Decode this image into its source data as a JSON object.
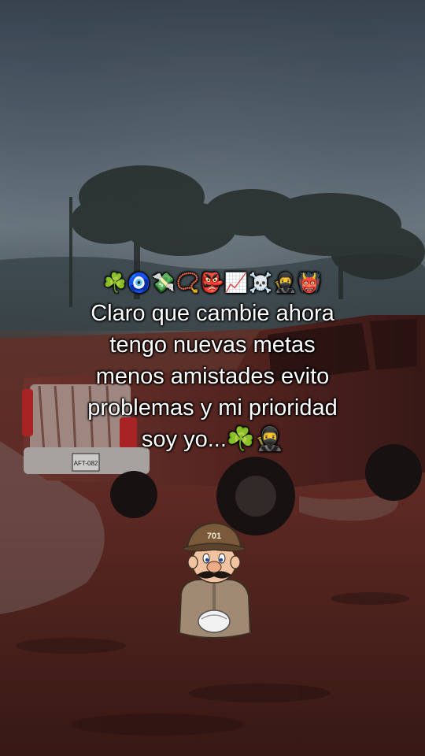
{
  "caption": {
    "emojis": "☘️🧿💸📿👺📈☠️🥷👹",
    "lines": [
      "Claro que cambie ahora",
      "tengo nuevas metas",
      "menos amistades evito",
      "problemas y mi prioridad",
      "soy yo...☘️🥷"
    ]
  },
  "mascot": {
    "hat_text": "701"
  },
  "truck": {
    "plate": "AFT-082"
  }
}
